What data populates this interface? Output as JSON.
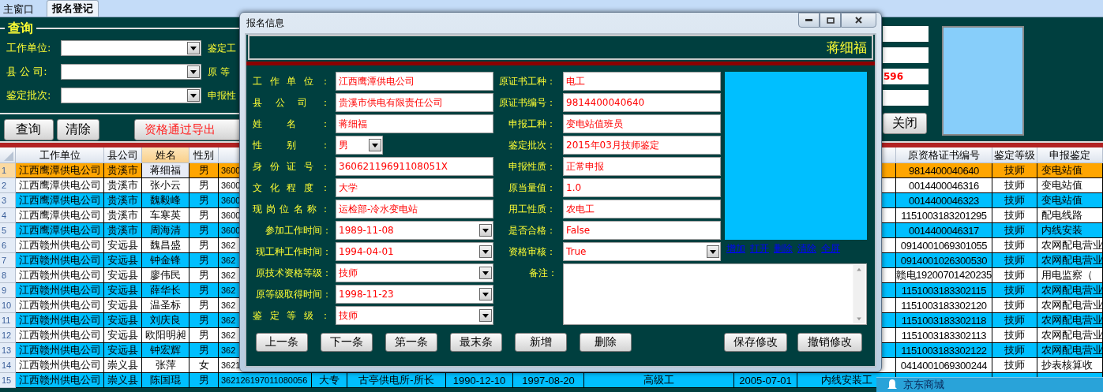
{
  "tabs": [
    {
      "label": "主窗口",
      "selected": false
    },
    {
      "label": "报名登记",
      "selected": true
    }
  ],
  "query": {
    "title": "查询",
    "rows": [
      {
        "label": "工作单位:",
        "label_2": "鉴定工"
      },
      {
        "label": "县 公 司:",
        "label_2": "原 等"
      },
      {
        "label": "鉴定批次:",
        "label_2": "申报性"
      }
    ],
    "buttons": [
      {
        "label": "查询",
        "kind": "plain"
      },
      {
        "label": "清除",
        "kind": "plain"
      },
      {
        "label": "资格通过导出",
        "kind": "alert"
      }
    ],
    "side_fields": [
      {
        "kind": "text"
      },
      {
        "kind": "text"
      },
      {
        "kind": "text",
        "value": "596"
      },
      {
        "kind": "text"
      }
    ],
    "close_button": "关闭"
  },
  "table": {
    "columns": [
      {
        "label": "工作单位",
        "selected": false
      },
      {
        "label": "县公司",
        "selected": false
      },
      {
        "label": "姓名",
        "selected": true
      },
      {
        "label": "性别",
        "selected": false
      },
      null,
      null,
      null,
      null,
      null,
      null,
      null,
      null,
      {
        "label": "原资格证书编号",
        "selected": false
      },
      {
        "label": "鉴定等级",
        "selected": false
      },
      {
        "label": "申报鉴定",
        "selected": false
      }
    ],
    "rows": [
      {
        "number": "1",
        "selected": true,
        "cells": [
          "江西鹰潭供电公司",
          "贵溪市",
          "蒋细福",
          "男",
          "3600",
          null,
          null,
          null,
          null,
          null,
          null,
          null,
          "9814400040640",
          "技师",
          "变电站值"
        ]
      },
      {
        "number": "2",
        "selected": false,
        "cells": [
          "江西鹰潭供电公司",
          "贵溪市",
          "张小云",
          "男",
          "3600",
          null,
          null,
          null,
          null,
          null,
          null,
          null,
          "0014400046316",
          "技师",
          "变电站值"
        ]
      },
      {
        "number": "3",
        "selected": false,
        "cells": [
          "江西鹰潭供电公司",
          "贵溪市",
          "魏毅峰",
          "男",
          "3600",
          null,
          null,
          null,
          null,
          null,
          null,
          null,
          "0014400046323",
          "技师",
          "变电站值"
        ]
      },
      {
        "number": "4",
        "selected": false,
        "cells": [
          "江西鹰潭供电公司",
          "贵溪市",
          "车寒英",
          "男",
          "3600",
          null,
          null,
          null,
          null,
          null,
          null,
          null,
          "1151003183201295",
          "技师",
          "配电线路"
        ]
      },
      {
        "number": "5",
        "selected": false,
        "cells": [
          "江西鹰潭供电公司",
          "贵溪市",
          "周海清",
          "男",
          "3600",
          null,
          null,
          null,
          null,
          null,
          null,
          null,
          "0014400046317",
          "技师",
          "内线安装"
        ]
      },
      {
        "number": "6",
        "selected": false,
        "cells": [
          "江西赣州供电公司",
          "安远县",
          "魏昌盛",
          "男",
          "362",
          null,
          null,
          null,
          null,
          null,
          null,
          null,
          "0914001069301055",
          "技师",
          "农网配电营业"
        ]
      },
      {
        "number": "7",
        "selected": false,
        "cells": [
          "江西赣州供电公司",
          "安远县",
          "钟金锋",
          "男",
          "362",
          null,
          null,
          null,
          null,
          null,
          null,
          null,
          "0914001026300530",
          "技师",
          "农网配电营业"
        ]
      },
      {
        "number": "8",
        "selected": false,
        "cells": [
          "江西赣州供电公司",
          "安远县",
          "廖伟民",
          "男",
          "362",
          null,
          null,
          null,
          null,
          null,
          null,
          null,
          "赣电19200701420235",
          "技师",
          "用电监察（"
        ]
      },
      {
        "number": "9",
        "selected": false,
        "cells": [
          "江西赣州供电公司",
          "安远县",
          "薛华长",
          "男",
          "362",
          null,
          null,
          null,
          null,
          null,
          null,
          null,
          "1151003183302115",
          "技师",
          "农网配电营业"
        ]
      },
      {
        "number": "10",
        "selected": false,
        "cells": [
          "江西赣州供电公司",
          "安远县",
          "温圣标",
          "男",
          "362",
          null,
          null,
          null,
          null,
          null,
          null,
          null,
          "1151003183302120",
          "技师",
          "农网配电营业"
        ]
      },
      {
        "number": "11",
        "selected": false,
        "cells": [
          "江西赣州供电公司",
          "安远县",
          "刘庆良",
          "男",
          "362",
          null,
          null,
          null,
          null,
          null,
          null,
          null,
          "1151003183302118",
          "技师",
          "农网配电营业"
        ]
      },
      {
        "number": "12",
        "selected": false,
        "cells": [
          "江西赣州供电公司",
          "安远县",
          "欧阳明昶",
          "男",
          "362",
          null,
          null,
          null,
          null,
          null,
          null,
          null,
          "1151003183302113",
          "技师",
          "农网配电营业"
        ]
      },
      {
        "number": "13",
        "selected": false,
        "cells": [
          "江西赣州供电公司",
          "安远县",
          "钟宏辉",
          "男",
          "362",
          null,
          null,
          null,
          null,
          null,
          null,
          null,
          "1151003183302122",
          "技师",
          "农网配电营业"
        ]
      },
      {
        "number": "14",
        "selected": false,
        "cells": [
          "江西赣州供电公司",
          "崇义县",
          "张萍",
          "女",
          "3621",
          null,
          null,
          null,
          null,
          null,
          null,
          null,
          "0414001069300244",
          "技师",
          "抄表核算收"
        ]
      },
      {
        "number": "15",
        "selected": false,
        "cells": [
          "江西赣州供电公司",
          "崇义县",
          "陈国琨",
          "男",
          "362126197011080056",
          "大专",
          "古亭供电所-所长",
          "1990-12-10",
          "1997-08-20",
          "高级工",
          "2005-07-01",
          "内线安装工",
          null,
          null,
          null
        ]
      }
    ]
  },
  "dialog": {
    "title": "报名信息",
    "name": "蒋细福",
    "left_fields": [
      {
        "label": "工作单位：",
        "kind": "text",
        "value": "江西鹰潭供电公司"
      },
      {
        "label": "县公司：",
        "kind": "text",
        "value": "贵溪市供电有限责任公司"
      },
      {
        "label": "姓名：",
        "kind": "text",
        "value": "蒋细福"
      },
      {
        "label": "性别：",
        "kind": "small-combo",
        "value": "男"
      },
      {
        "label": "身份证号：",
        "kind": "text",
        "value": "36062119691108051X"
      },
      {
        "label": "文化程度：",
        "kind": "text",
        "value": "大学"
      },
      {
        "label": "现岗位名称：",
        "kind": "text",
        "value": "运检部-冷水变电站"
      },
      {
        "label": "参加工作时间：",
        "kind": "combo",
        "value": "1989-11-08"
      },
      {
        "label": "现工种工作时间：",
        "kind": "combo",
        "value": "1994-04-01"
      },
      {
        "label": "原技术资格等级：",
        "kind": "combo",
        "value": "技师"
      },
      {
        "label": "原等级取得时间：",
        "kind": "combo",
        "value": "1998-11-23"
      },
      {
        "label": "鉴定等级：",
        "kind": "combo",
        "value": "技师"
      }
    ],
    "middle_fields": [
      {
        "label": "原证书工种：",
        "kind": "text",
        "value": "电工"
      },
      {
        "label": "原证书编号：",
        "kind": "text",
        "value": "9814400040640"
      },
      {
        "label": "申报工种：",
        "kind": "text",
        "value": "变电站值班员"
      },
      {
        "label": "鉴定批次：",
        "kind": "text",
        "value": "2015年03月技师鉴定"
      },
      {
        "label": "申报性质：",
        "kind": "text",
        "value": "正常申报"
      },
      {
        "label": "原当量值：",
        "kind": "text",
        "value": "1.0"
      },
      {
        "label": "用工性质：",
        "kind": "text",
        "value": "农电工"
      },
      {
        "label": "是否合格：",
        "kind": "text",
        "value": "False"
      },
      {
        "label": "资格审核：",
        "kind": "combo",
        "value": "True"
      }
    ],
    "remarks_label": "备注：",
    "photo_links": [
      "增加",
      "打开",
      "删除",
      "清除",
      "全屏"
    ],
    "nav_buttons": [
      "上一条",
      "下一条",
      "第一条",
      "最末条",
      "新增",
      "删除"
    ],
    "edit_buttons": [
      "保存修改",
      "撤销修改"
    ]
  },
  "notification": {
    "title": "京东商城"
  }
}
